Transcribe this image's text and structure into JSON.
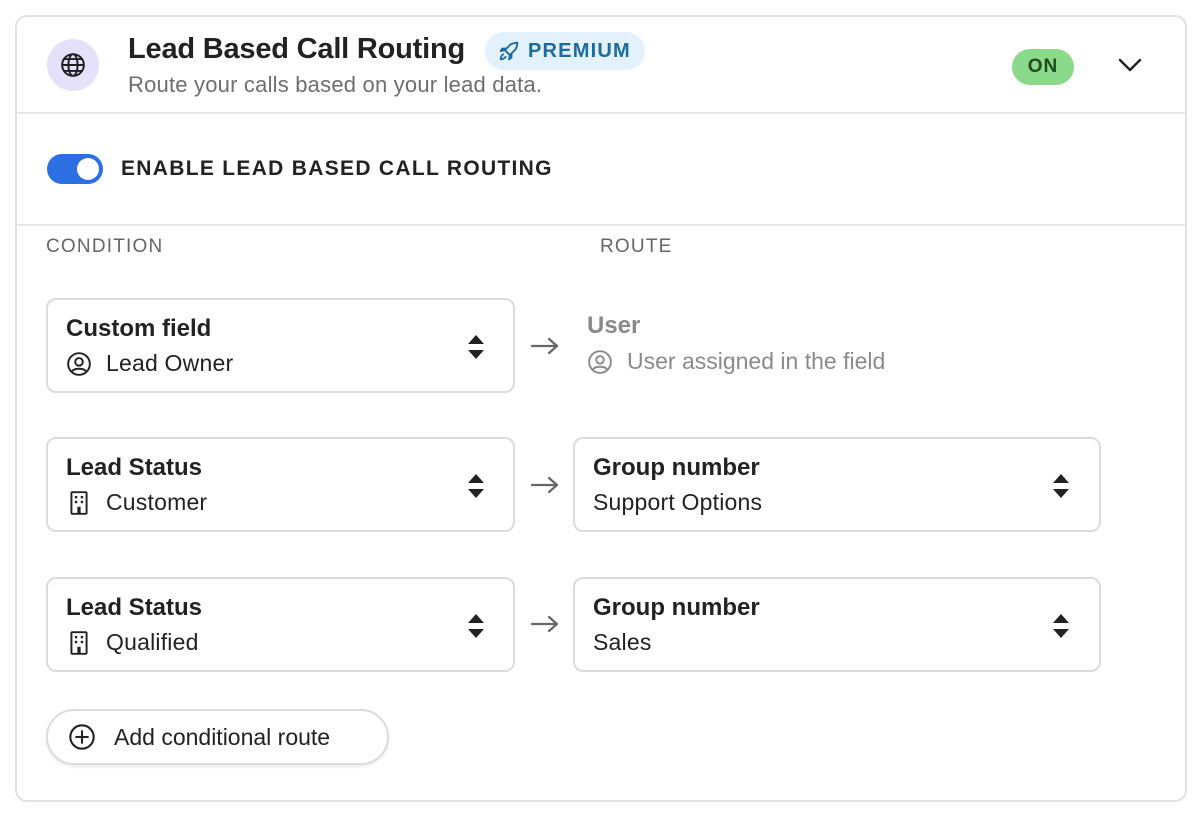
{
  "header": {
    "icon": "globe-icon",
    "title": "Lead Based Call Routing",
    "premium_label": "PREMIUM",
    "premium_icon": "rocket-icon",
    "subtitle": "Route your calls based on your lead data.",
    "status": "ON",
    "expand_icon": "chevron-down-icon"
  },
  "toggle": {
    "label": "ENABLE LEAD BASED CALL ROUTING",
    "enabled": true
  },
  "columns": {
    "condition": "CONDITION",
    "route": "ROUTE"
  },
  "rules": [
    {
      "condition_title": "Custom field",
      "condition_value": "Lead Owner",
      "condition_icon": "user-circle-icon",
      "route_title": "User",
      "route_value": "User assigned in the field",
      "route_icon": "user-circle-icon",
      "route_editable": false
    },
    {
      "condition_title": "Lead Status",
      "condition_value": "Customer",
      "condition_icon": "building-icon",
      "route_title": "Group number",
      "route_value": "Support Options",
      "route_editable": true
    },
    {
      "condition_title": "Lead Status",
      "condition_value": "Qualified",
      "condition_icon": "building-icon",
      "route_title": "Group number",
      "route_value": "Sales",
      "route_editable": true
    }
  ],
  "add_button": {
    "label": "Add conditional route",
    "icon": "plus-circle-icon"
  },
  "colors": {
    "accent": "#2c6fe3",
    "on_badge": "#8bd98b",
    "premium_bg": "#e3f1fd",
    "premium_text": "#1b6aa0",
    "icon_circle": "#e6e1fb"
  }
}
